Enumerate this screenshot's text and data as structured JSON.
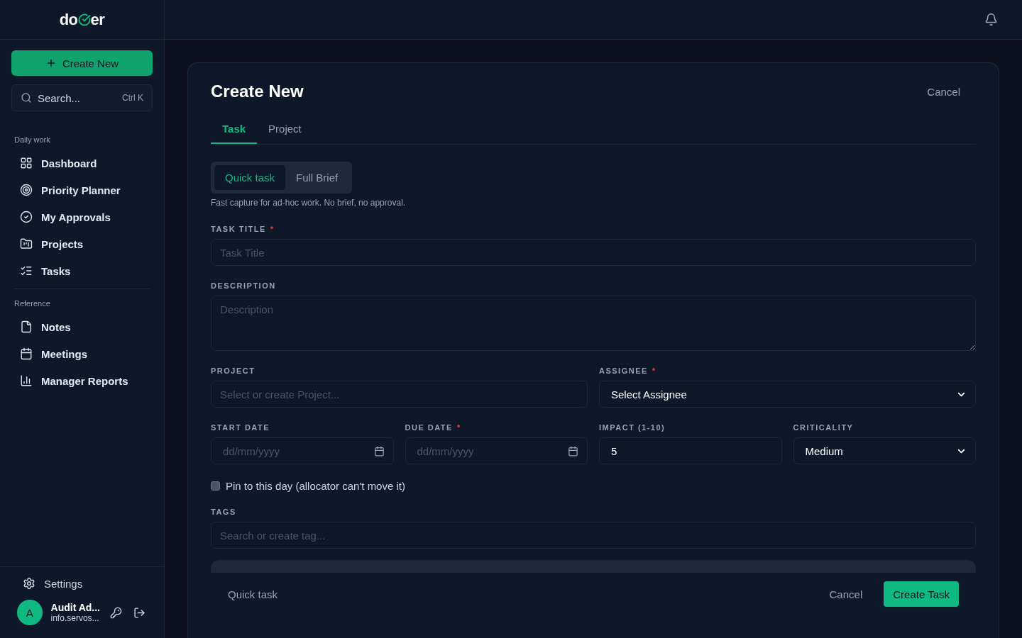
{
  "logo": {
    "before": "do",
    "after": "er"
  },
  "sidebar": {
    "create_button": "Create New",
    "search": {
      "placeholder": "Search...",
      "shortcut": "Ctrl K"
    },
    "sections": [
      {
        "title": "Daily work",
        "items": [
          {
            "label": "Dashboard",
            "selected": false
          },
          {
            "label": "Priority Planner",
            "selected": false
          },
          {
            "label": "My Approvals",
            "selected": false
          },
          {
            "label": "Projects",
            "selected": false
          },
          {
            "label": "Tasks",
            "selected": false
          }
        ]
      },
      {
        "title": "Reference",
        "items": [
          {
            "label": "Notes",
            "selected": false
          },
          {
            "label": "Meetings",
            "selected": false
          },
          {
            "label": "Manager Reports",
            "selected": false
          }
        ]
      }
    ],
    "settings": "Settings",
    "user": {
      "initial": "A",
      "name": "Audit Ad...",
      "email": "info.servos..."
    }
  },
  "form": {
    "title": "Create New",
    "cancel": "Cancel",
    "tabs": [
      {
        "label": "Task",
        "selected": true
      },
      {
        "label": "Project",
        "selected": false
      }
    ],
    "modes": [
      {
        "label": "Quick task",
        "selected": true
      },
      {
        "label": "Full Brief",
        "selected": false
      }
    ],
    "mode_hint": "Fast capture for ad-hoc work. No brief, no approval.",
    "rows": [
      {
        "groups": [
          [
            {
              "kind": "text",
              "label": "TASK TITLE",
              "marker": "*",
              "placeholder": "Task Title"
            }
          ]
        ]
      },
      {
        "groups": [
          [
            {
              "kind": "textarea",
              "label": "DESCRIPTION",
              "placeholder": "Description"
            }
          ]
        ]
      },
      {
        "groups": [
          [
            {
              "kind": "text",
              "label": "PROJECT",
              "placeholder": "Select or create Project..."
            }
          ],
          [
            {
              "kind": "select",
              "label": "ASSIGNEE",
              "marker": "*",
              "value": "Select Assignee"
            }
          ]
        ]
      },
      {
        "groups": [
          [
            {
              "kind": "date",
              "label": "START DATE",
              "placeholder": "dd/mm/yyyy"
            },
            {
              "kind": "date",
              "label": "DUE DATE",
              "marker": "*",
              "placeholder": "dd/mm/yyyy"
            }
          ],
          [
            {
              "kind": "text",
              "label": "IMPACT (1-10)",
              "value": "5"
            },
            {
              "kind": "select",
              "label": "CRITICALITY",
              "value": "Medium"
            }
          ]
        ]
      },
      {
        "groups": [
          [
            {
              "kind": "checkbox",
              "label": "Pin to this day (allocator can't move it)",
              "checked": false
            }
          ]
        ]
      },
      {
        "groups": [
          [
            {
              "kind": "text",
              "label": "TAGS",
              "placeholder": "Search or create tag..."
            }
          ]
        ]
      }
    ],
    "footer": {
      "mode": "Quick task",
      "cancel": "Cancel",
      "submit": "Create Task"
    }
  }
}
